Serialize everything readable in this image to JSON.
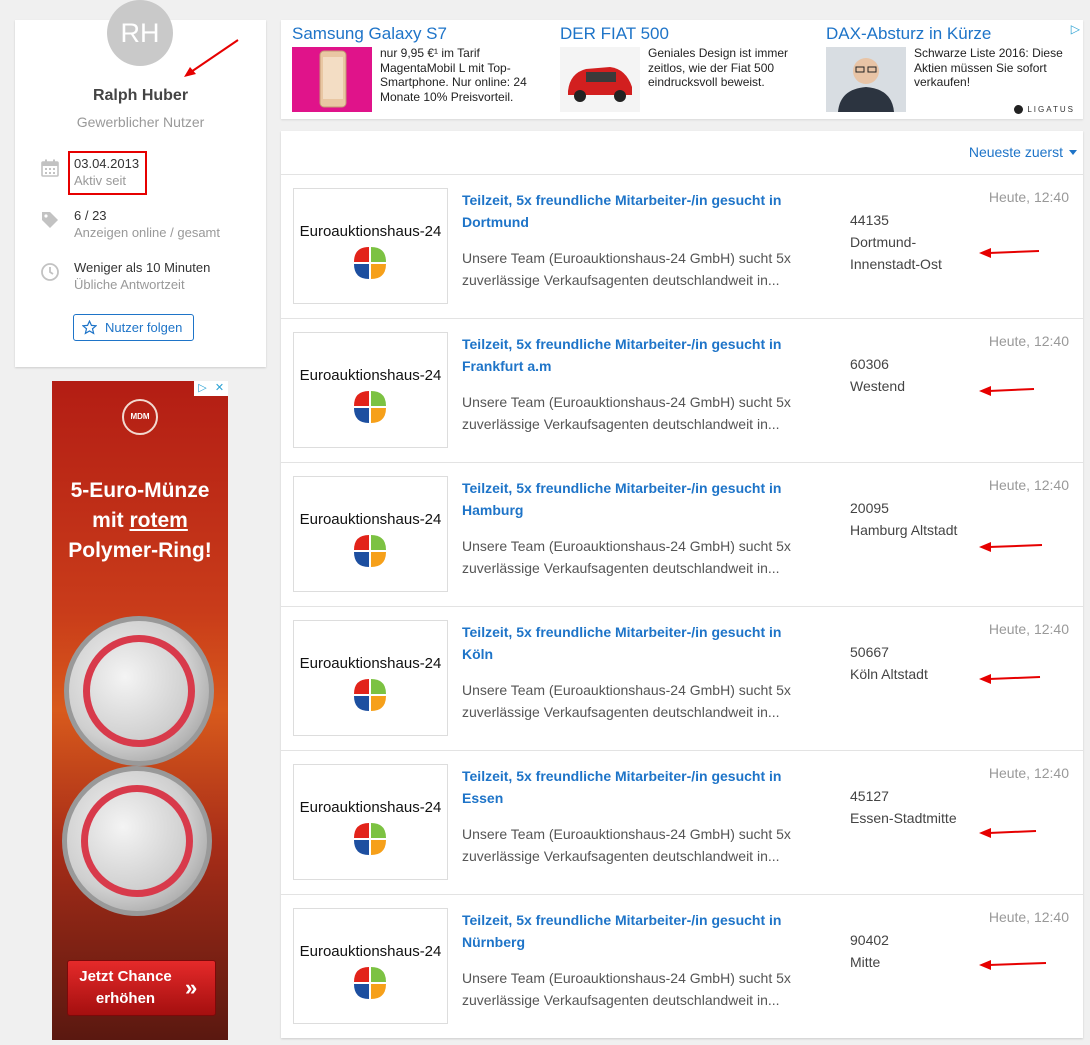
{
  "profile": {
    "initials": "RH",
    "name": "Ralph Huber",
    "user_type": "Gewerblicher Nutzer",
    "active_since_value": "03.04.2013",
    "active_since_label": "Aktiv seit",
    "ads_value": "6 / 23",
    "ads_label": "Anzeigen online / gesamt",
    "response_value": "Weniger als 10 Minuten",
    "response_label": "Übliche Antwortzeit",
    "follow_label": "Nutzer folgen"
  },
  "side_ad": {
    "brand": "MDM",
    "headline_1": "5-Euro-Münze",
    "headline_2a": "mit ",
    "headline_2b": "rotem",
    "headline_3": "Polymer-Ring!",
    "cta": "Jetzt Chance erhöhen",
    "cta_icon": "double-chevron-right-icon"
  },
  "top_ads": {
    "items": [
      {
        "title": "Samsung Galaxy S7",
        "text": "nur 9,95 €¹ im Tarif MagentaMobil L mit Top-Smartphone. Nur online: 24 Monate 10% Preisvorteil."
      },
      {
        "title": "DER FIAT 500",
        "text": "Geniales Design ist immer zeitlos, wie der Fiat 500 eindrucksvoll beweist."
      },
      {
        "title": "DAX-Absturz in Kürze",
        "text": "Schwarze Liste 2016: Diese Aktien müssen Sie sofort verkaufen!"
      }
    ],
    "provider": "LIGATUS"
  },
  "listing": {
    "sort_label": "Neueste zuerst",
    "logo_text": "Euroauktionshaus-24",
    "items": [
      {
        "title": "Teilzeit, 5x freundliche Mitarbeiter-/in gesucht in Dortmund",
        "description": "Unsere Team (Euroauktionshaus-24 GmbH) sucht 5x zuverlässige Verkaufsagenten deutschlandweit in...",
        "zip": "44135",
        "district": "Dortmund-Innenstadt-Ost",
        "time": "Heute, 12:40"
      },
      {
        "title": "Teilzeit, 5x freundliche Mitarbeiter-/in gesucht in Frankfurt a.m",
        "description": "Unsere Team (Euroauktionshaus-24 GmbH) sucht 5x zuverlässige Verkaufsagenten deutschlandweit in...",
        "zip": "60306",
        "district": "Westend",
        "time": "Heute, 12:40"
      },
      {
        "title": "Teilzeit, 5x freundliche Mitarbeiter-/in gesucht in Hamburg",
        "description": "Unsere Team (Euroauktionshaus-24 GmbH) sucht 5x zuverlässige Verkaufsagenten deutschlandweit in...",
        "zip": "20095",
        "district": "Hamburg Altstadt",
        "time": "Heute, 12:40"
      },
      {
        "title": "Teilzeit, 5x freundliche Mitarbeiter-/in gesucht in Köln",
        "description": "Unsere Team (Euroauktionshaus-24 GmbH) sucht 5x zuverlässige Verkaufsagenten deutschlandweit in...",
        "zip": "50667",
        "district": "Köln Altstadt",
        "time": "Heute, 12:40"
      },
      {
        "title": "Teilzeit, 5x freundliche Mitarbeiter-/in gesucht in Essen",
        "description": "Unsere Team (Euroauktionshaus-24 GmbH) sucht 5x zuverlässige Verkaufsagenten deutschlandweit in...",
        "zip": "45127",
        "district": "Essen-Stadtmitte",
        "time": "Heute, 12:40"
      },
      {
        "title": "Teilzeit, 5x freundliche Mitarbeiter-/in gesucht in Nürnberg",
        "description": "Unsere Team (Euroauktionshaus-24 GmbH) sucht 5x zuverlässige Verkaufsagenten deutschlandweit in...",
        "zip": "90402",
        "district": "Mitte",
        "time": "Heute, 12:40"
      }
    ]
  },
  "colors": {
    "link": "#1e74c8",
    "annotation": "#e60000",
    "muted": "#999999",
    "background": "#f0f0f0"
  }
}
